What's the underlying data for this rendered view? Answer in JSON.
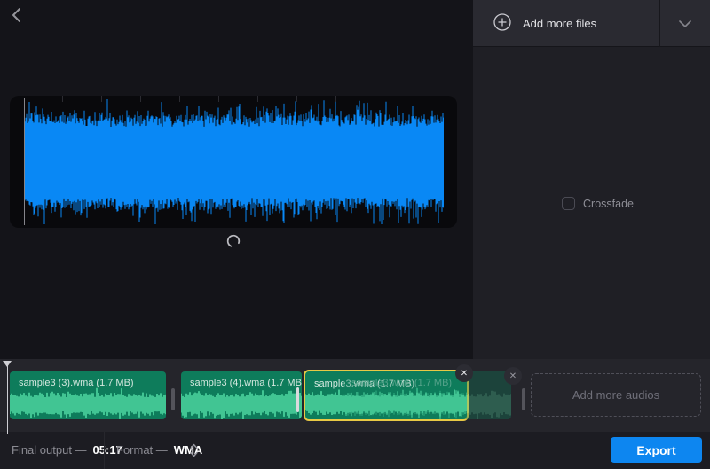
{
  "window": {
    "back_icon": "chevron-left"
  },
  "right_panel": {
    "add_more_files_label": "Add more files",
    "crossfade_label": "Crossfade",
    "crossfade_checked": false
  },
  "preview": {
    "state": "loading-spinner"
  },
  "timeline": {
    "clips": [
      {
        "label": "sample3 (3).wma (1.7 MB)"
      },
      {
        "label": "sample3 (4).wma (1.7 MB)"
      },
      {
        "label": "sample3.wma (1.7 MB)",
        "selected": true
      }
    ],
    "ghost_clip_label": "sample3.wma (1.7 MB)",
    "add_more_audios_label": "Add more audios",
    "close_icon": "✕"
  },
  "footer": {
    "final_output_label": "Final output —",
    "final_output_value": "05:17",
    "format_label": "Format —",
    "format_value": "WMA",
    "export_label": "Export"
  },
  "colors": {
    "accent_blue": "#0d86f0",
    "waveform_blue": "#0988f5",
    "clip_green": "#0e7c5b",
    "clip_wave_green": "#41c593",
    "selection_yellow": "#e8c945",
    "panel_bg": "#1f1f25",
    "timeline_bg": "#25252b"
  }
}
